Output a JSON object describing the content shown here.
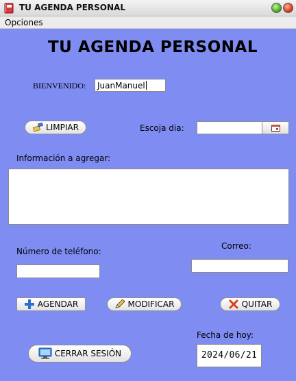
{
  "window": {
    "title": "TU AGENDA PERSONAL",
    "icons": {
      "app": "agenda-book-icon",
      "minimize": "green-circle-icon",
      "close": "red-circle-icon"
    }
  },
  "menubar": {
    "items": [
      "Opciones"
    ]
  },
  "heading": "TU AGENDA PERSONAL",
  "welcome": {
    "label": "BIENVENIDO:",
    "username": "JuanManuel"
  },
  "clear_button": {
    "label": "LIMPIAR",
    "icon": "broom-icon"
  },
  "day_picker": {
    "label": "Escoja dia:",
    "value": "",
    "button_icon": "calendar-icon"
  },
  "info": {
    "label": "Información a agregar:",
    "value": ""
  },
  "phone": {
    "label": "Número de teléfono:",
    "value": ""
  },
  "email": {
    "label": "Correo:",
    "value": ""
  },
  "actions": {
    "schedule": {
      "label": "AGENDAR",
      "icon": "plus-icon"
    },
    "modify": {
      "label": "MODIFICAR",
      "icon": "pencil-icon"
    },
    "delete": {
      "label": "QUITAR",
      "icon": "x-icon"
    }
  },
  "logout": {
    "label": "CERRAR SESIÓN",
    "icon": "monitor-icon"
  },
  "today": {
    "label": "Fecha de hoy:",
    "value": "2024/06/21"
  },
  "colors": {
    "background": "#7f8cf2",
    "plus": "#2a6fd1",
    "delete": "#e03c1c"
  }
}
